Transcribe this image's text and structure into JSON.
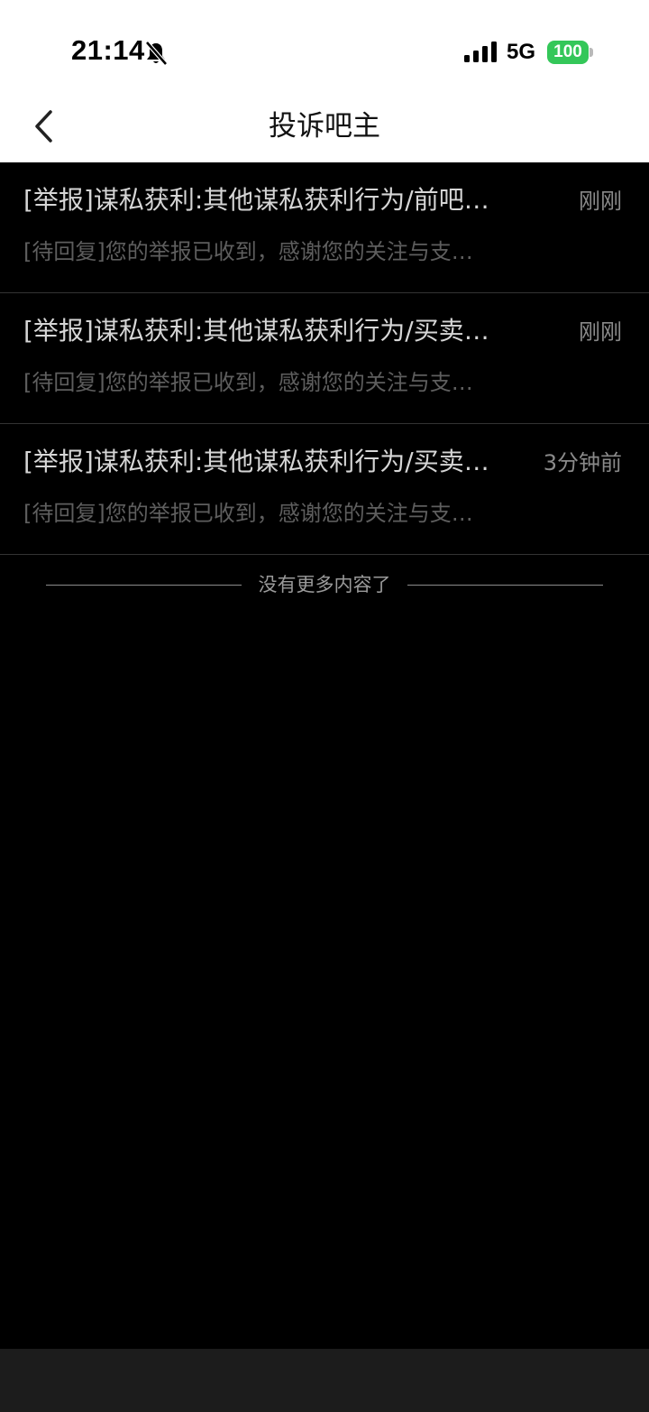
{
  "status_bar": {
    "time": "21:14",
    "network": "5G",
    "battery": "100",
    "icons": [
      "bell-slash-icon",
      "signal-icon"
    ]
  },
  "nav": {
    "title": "投诉吧主",
    "back_icon": "chevron-left-icon"
  },
  "items": [
    {
      "title": "[举报]谋私获利:其他谋私获利行为/前吧…",
      "time": "刚刚",
      "subtitle": "[待回复]您的举报已收到，感谢您的关注与支…"
    },
    {
      "title": "[举报]谋私获利:其他谋私获利行为/买卖…",
      "time": "刚刚",
      "subtitle": "[待回复]您的举报已收到，感谢您的关注与支…"
    },
    {
      "title": "[举报]谋私获利:其他谋私获利行为/买卖…",
      "time": "3分钟前",
      "subtitle": "[待回复]您的举报已收到，感谢您的关注与支…"
    }
  ],
  "footer": {
    "end_text": "没有更多内容了"
  },
  "colors": {
    "background": "#000000",
    "header_background": "#ffffff",
    "battery": "#34c759",
    "bottom_bar": "#1c1c1c"
  }
}
